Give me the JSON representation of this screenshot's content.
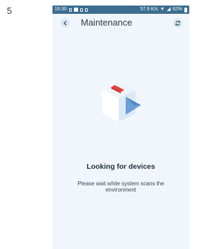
{
  "page_number": "5",
  "status_bar": {
    "time": "16:30",
    "network_speed": "57.9 K/s",
    "battery": "62%"
  },
  "header": {
    "title": "Maintenance"
  },
  "content": {
    "heading": "Looking for devices",
    "message": "Please wait while system scans the environment"
  },
  "icons": {
    "back": "chevron-left-icon",
    "refresh": "refresh-icon",
    "illustration": "device-box-icon"
  },
  "colors": {
    "status_bar": "#3b6d8f",
    "screen_background": "#f0f6fc",
    "accent_red": "#e8403a",
    "box_blue": "#6c9fd6"
  }
}
